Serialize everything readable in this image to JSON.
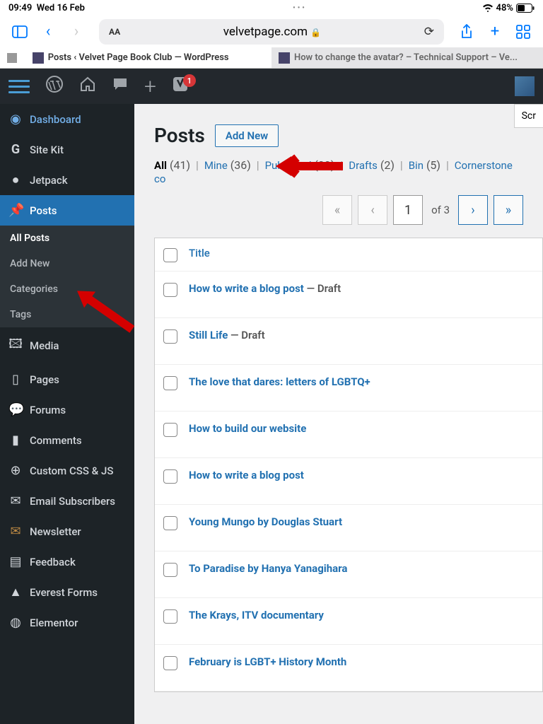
{
  "status": {
    "time": "09:49",
    "date": "Wed 16 Feb",
    "battery": "48%"
  },
  "browser": {
    "url": "velvetpage.com",
    "tab1": "Posts ‹ Velvet Page Book Club — WordPress",
    "tab2": "How to change the avatar? – Technical Support – Ve..."
  },
  "adminbar": {
    "notif": "1"
  },
  "sidebar": {
    "dashboard": "Dashboard",
    "sitekit": "Site Kit",
    "jetpack": "Jetpack",
    "posts": "Posts",
    "sub": {
      "all": "All Posts",
      "add": "Add New",
      "cats": "Categories",
      "tags": "Tags"
    },
    "media": "Media",
    "pages": "Pages",
    "forums": "Forums",
    "comments": "Comments",
    "css": "Custom CSS & JS",
    "email": "Email Subscribers",
    "news": "Newsletter",
    "feedback": "Feedback",
    "everest": "Everest Forms",
    "elementor": "Elementor"
  },
  "screen": {
    "tab": "Scr"
  },
  "page": {
    "title": "Posts",
    "addnew": "Add New"
  },
  "filters": {
    "all": "All",
    "all_n": "(41)",
    "mine": "Mine",
    "mine_n": "(36)",
    "pub": "Published",
    "pub_n": "(39)",
    "drafts": "Drafts",
    "drafts_n": "(2)",
    "bin": "Bin",
    "bin_n": "(5)",
    "corner": "Cornerstone co"
  },
  "pager": {
    "page": "1",
    "of": "of 3",
    "next": "›",
    "last": "»",
    "prev": "‹",
    "first": "«"
  },
  "table": {
    "title_col": "Title",
    "posts": [
      {
        "title": "How to write a blog post",
        "status": " — Draft"
      },
      {
        "title": "Still Life",
        "status": " — Draft"
      },
      {
        "title": "The love that dares: letters of LGBTQ+",
        "status": ""
      },
      {
        "title": "How to build our website",
        "status": ""
      },
      {
        "title": "How to write a blog post",
        "status": ""
      },
      {
        "title": "Young Mungo by Douglas Stuart",
        "status": ""
      },
      {
        "title": "To Paradise by Hanya Yanagihara",
        "status": ""
      },
      {
        "title": "The Krays, ITV documentary",
        "status": ""
      },
      {
        "title": "February is LGBT+ History Month",
        "status": ""
      }
    ]
  }
}
